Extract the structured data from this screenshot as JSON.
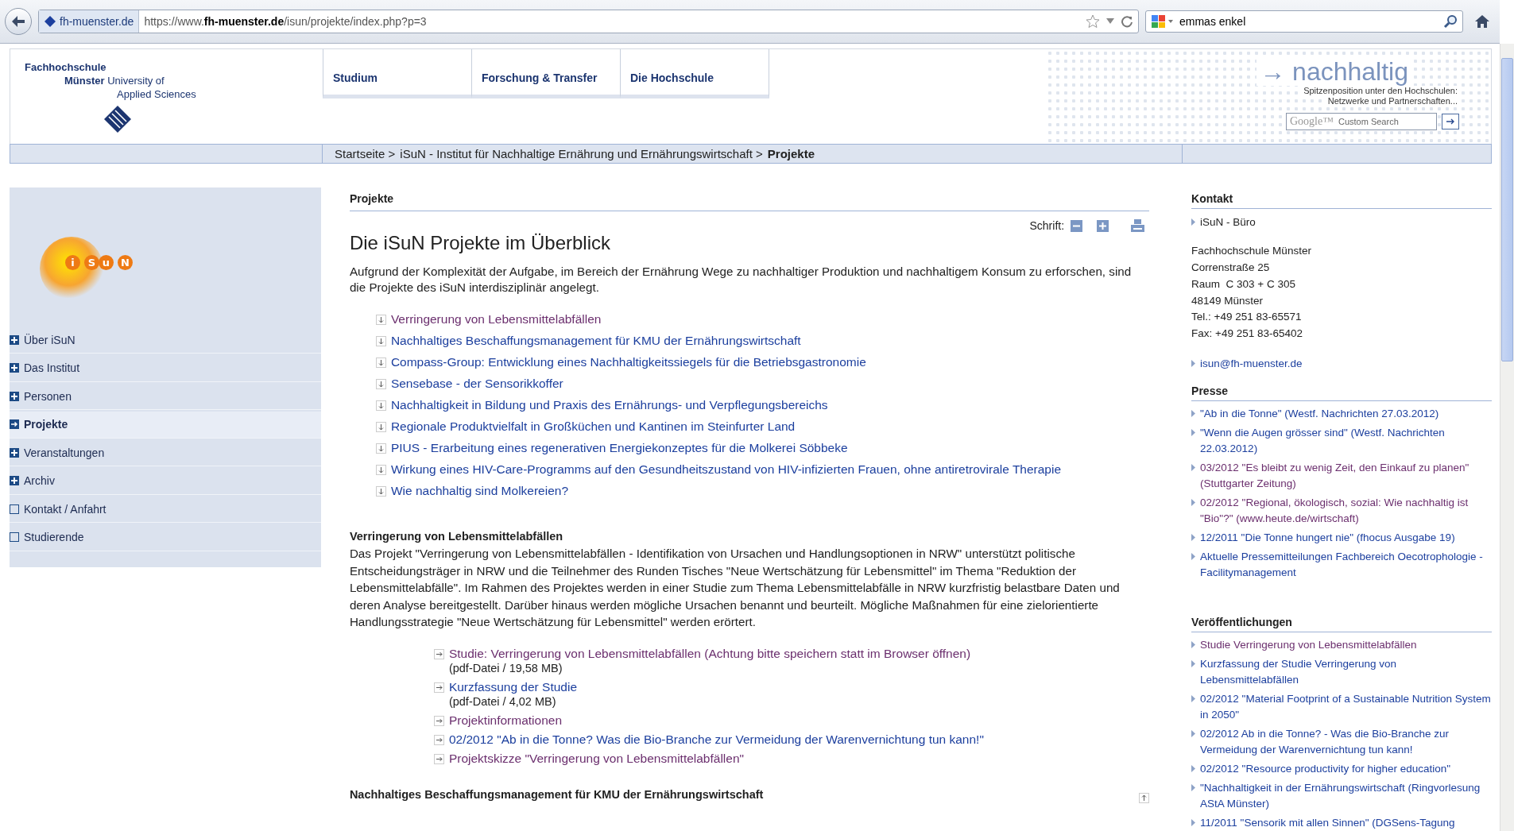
{
  "browser": {
    "site": "fh-muenster.de",
    "url": "https://www.**fh-muenster.de**/isun/projekte/index.php?p=3",
    "search_value": "emmas enkel"
  },
  "header": {
    "logo_line1": "Fachhochschule",
    "logo_line2_bold": "Münster",
    "logo_line2": "University of",
    "logo_line3": "Applied Sciences",
    "nav_tabs": [
      {
        "label": "Studium",
        "selected": false
      },
      {
        "label": "Forschung & Transfer",
        "selected": false
      },
      {
        "label": "Die Hochschule",
        "selected": false
      }
    ],
    "brand": "→ nachhaltig",
    "tagline": [
      "Spitzenposition unter den Hochschulen:",
      "Netzwerke und Partnerschaften..."
    ],
    "search_brand": "Google™",
    "search_placeholder": "Custom Search"
  },
  "breadcrumb": [
    {
      "label": "Startseite >",
      "current": false
    },
    {
      "label": "iSuN - Institut für Nachhaltige Ernährung und Ernährungswirtschaft >",
      "current": false
    },
    {
      "label": "Projekte",
      "current": true
    }
  ],
  "sidebar": {
    "logo_letters": [
      "i",
      "S",
      "u",
      "N"
    ],
    "items": [
      {
        "label": "Über iSuN",
        "kind": "expandable",
        "selected": false
      },
      {
        "label": "Das Institut",
        "kind": "expandable",
        "selected": false
      },
      {
        "label": "Personen",
        "kind": "expandable",
        "selected": false
      },
      {
        "label": "Projekte",
        "kind": "current",
        "selected": true
      },
      {
        "label": "Veranstaltungen",
        "kind": "expandable",
        "selected": false
      },
      {
        "label": "Archiv",
        "kind": "expandable",
        "selected": false
      },
      {
        "label": "Kontakt / Anfahrt",
        "kind": "leaf",
        "selected": false
      },
      {
        "label": "Studierende",
        "kind": "leaf",
        "selected": false
      }
    ]
  },
  "main": {
    "section_title": "Projekte",
    "font_label": "Schrift:",
    "heading": "Die iSuN Projekte im Überblick",
    "intro": "Aufgrund der Komplexität der Aufgabe, im Bereich der Ernährung Wege zu nachhaltiger Produktion und nachhaltigem Konsum zu erforschen, sind die Projekte des iSuN interdisziplinär angelegt.",
    "project_links": [
      {
        "label": "Verringerung von Lebensmittelabfällen",
        "visited": true
      },
      {
        "label": "Nachhaltiges Beschaffungsmanagement für KMU der Ernährungswirtschaft",
        "visited": false
      },
      {
        "label": "Compass-Group: Entwicklung eines Nachhaltigkeitssiegels für die Betriebsgastronomie",
        "visited": false
      },
      {
        "label": "Sensebase - der Sensorikkoffer",
        "visited": false
      },
      {
        "label": "Nachhaltigkeit in Bildung und Praxis des Ernährungs- und Verpflegungsbereichs",
        "visited": false
      },
      {
        "label": "Regionale Produktvielfalt in Großküchen und Kantinen im Steinfurter Land",
        "visited": false
      },
      {
        "label": "PIUS - Erarbeitung eines regenerativen Energiekonzeptes für die Molkerei Söbbeke",
        "visited": false
      },
      {
        "label": "Wirkung eines HIV-Care-Programms auf den Gesundheitszustand von HIV-infizierten Frauen, ohne antiretrovirale Therapie",
        "visited": false
      },
      {
        "label": "Wie nachhaltig sind Molkereien?",
        "visited": false
      }
    ],
    "sections": [
      {
        "title": "Verringerung von Lebensmittelabfällen",
        "text": "Das Projekt \"Verringerung von Lebensmittelabfällen - Identifikation von Ursachen und Handlungsoptionen in NRW\" unterstützt politische Entscheidungsträger in NRW und die Teilnehmer des Runden Tisches \"Neue Wertschätzung für Lebensmittel\" im Thema \"Reduktion der Lebensmittelabfälle\". Im Rahmen des Projektes werden in einer Studie zum Thema Lebensmittelabfälle in NRW kurzfristig belastbare Daten und deren Analyse bereitgestellt. Darüber hinaus werden mögliche Ursachen benannt und beurteilt. Mögliche Maßnahmen für eine zielorientierte Handlungsstrategie \"Neue Wertschätzung für Lebensmittel\" werden erörtert.",
        "links": [
          {
            "label": "Studie: Verringerung von Lebensmittelabfällen (Achtung bitte speichern statt im Browser öffnen)",
            "visited": true,
            "note": "(pdf-Datei / 19,58 MB)"
          },
          {
            "label": "Kurzfassung der Studie",
            "visited": false,
            "note": "(pdf-Datei / 4,02 MB)"
          },
          {
            "label": "Projektinformationen",
            "visited": true
          },
          {
            "label": "02/2012 \"Ab in die Tonne? Was die Bio-Branche zur Vermeidung der Warenvernichtung tun kann!\"",
            "visited": false
          },
          {
            "label": "Projektskizze \"Verringerung von Lebensmittelabfällen\"",
            "visited": true
          }
        ]
      },
      {
        "title": "Nachhaltiges Beschaffungsmanagement für KMU der Ernährungswirtschaft"
      }
    ]
  },
  "right": {
    "contact_title": "Kontakt",
    "contact_office": "iSuN - Büro",
    "address": [
      "Fachhochschule Münster",
      "Correnstraße 25",
      "Raum  C 303 + C 305",
      "48149 Münster",
      "Tel.: +49 251 83-65571",
      "Fax: +49 251 83-65402"
    ],
    "email": "isun@fh-muenster.de",
    "press_title": "Presse",
    "press": [
      {
        "label": "\"Ab in die Tonne\" (Westf. Nachrichten 27.03.2012)",
        "visited": false
      },
      {
        "label": "\"Wenn die Augen grösser sind\" (Westf. Nachrichten 22.03.2012)",
        "visited": false
      },
      {
        "label": "03/2012 \"Es bleibt zu wenig Zeit, den Einkauf zu planen\" (Stuttgarter Zeitung)",
        "visited": true
      },
      {
        "label": "02/2012 \"Regional, ökologisch, sozial: Wie nachhaltig ist \"Bio\"?\" (www.heute.de/wirtschaft)",
        "visited": true
      },
      {
        "label": "12/2011 \"Die Tonne hungert nie\" (fhocus Ausgabe 19)",
        "visited": false
      },
      {
        "label": "Aktuelle Pressemitteilungen Fachbereich Oecotrophologie - Facilitymanagement",
        "visited": false
      }
    ],
    "pub_title": "Veröffentlichungen",
    "publications": [
      {
        "label": "Studie Verringerung von Lebensmittelabfällen",
        "visited": true
      },
      {
        "label": "Kurzfassung der Studie Verringerung von Lebensmittelabfällen",
        "visited": false
      },
      {
        "label": "02/2012 \"Material Footprint of a Sustainable Nutrition System in 2050\"",
        "visited": false
      },
      {
        "label": "02/2012 Ab in die Tonne? - Was die Bio-Branche zur Vermeidung der Warenvernichtung tun kann!",
        "visited": false
      },
      {
        "label": "02/2012 \"Resource productivity for higher education\"",
        "visited": false
      },
      {
        "label": "\"Nachhaltigkeit in der Ernährungswirtschaft (Ringvorlesung AStA Münster)",
        "visited": false
      },
      {
        "label": "11/2011 \"Sensorik mit allen Sinnen\" (DGSens-Tagung",
        "visited": false
      }
    ]
  }
}
